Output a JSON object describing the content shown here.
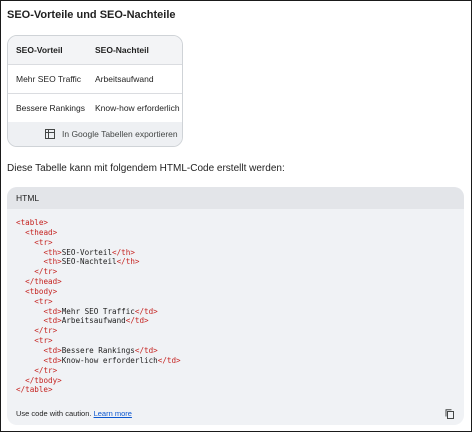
{
  "heading": "SEO-Vorteile und SEO-Nachteile",
  "table": {
    "headers": [
      "SEO-Vorteil",
      "SEO-Nachteil"
    ],
    "rows": [
      [
        "Mehr SEO Traffic",
        "Arbeitsaufwand"
      ],
      [
        "Bessere Rankings",
        "Know-how erforderlich"
      ]
    ],
    "export_label": "In Google Tabellen exportieren",
    "export_icon": "table-icon"
  },
  "intro_text": "Diese Tabelle kann mit folgendem HTML-Code erstellt werden:",
  "code": {
    "language": "HTML",
    "lines": [
      {
        "indent": "",
        "tag_open": "<table>",
        "text": "",
        "tag_close": ""
      },
      {
        "indent": "  ",
        "tag_open": "<thead>",
        "text": "",
        "tag_close": ""
      },
      {
        "indent": "    ",
        "tag_open": "<tr>",
        "text": "",
        "tag_close": ""
      },
      {
        "indent": "      ",
        "tag_open": "<th>",
        "text": "SEO-Vorteil",
        "tag_close": "</th>"
      },
      {
        "indent": "      ",
        "tag_open": "<th>",
        "text": "SEO-Nachteil",
        "tag_close": "</th>"
      },
      {
        "indent": "    ",
        "tag_open": "</tr>",
        "text": "",
        "tag_close": ""
      },
      {
        "indent": "  ",
        "tag_open": "</thead>",
        "text": "",
        "tag_close": ""
      },
      {
        "indent": "  ",
        "tag_open": "<tbody>",
        "text": "",
        "tag_close": ""
      },
      {
        "indent": "    ",
        "tag_open": "<tr>",
        "text": "",
        "tag_close": ""
      },
      {
        "indent": "      ",
        "tag_open": "<td>",
        "text": "Mehr SEO Traffic",
        "tag_close": "</td>"
      },
      {
        "indent": "      ",
        "tag_open": "<td>",
        "text": "Arbeitsaufwand",
        "tag_close": "</td>"
      },
      {
        "indent": "    ",
        "tag_open": "</tr>",
        "text": "",
        "tag_close": ""
      },
      {
        "indent": "    ",
        "tag_open": "<tr>",
        "text": "",
        "tag_close": ""
      },
      {
        "indent": "      ",
        "tag_open": "<td>",
        "text": "Bessere Rankings",
        "tag_close": "</td>"
      },
      {
        "indent": "      ",
        "tag_open": "<td>",
        "text": "Know-how erforderlich",
        "tag_close": "</td>"
      },
      {
        "indent": "    ",
        "tag_open": "</tr>",
        "text": "",
        "tag_close": ""
      },
      {
        "indent": "  ",
        "tag_open": "</tbody>",
        "text": "",
        "tag_close": ""
      },
      {
        "indent": "",
        "tag_open": "</table>",
        "text": "",
        "tag_close": ""
      }
    ],
    "caution_text": "Use code with caution.",
    "learn_more": "Learn more",
    "copy_icon": "copy-icon"
  },
  "colors": {
    "tag": "#c5221f",
    "link": "#0b57d0",
    "code_bg": "#f0f2f5",
    "header_bg": "#e3e5e9"
  }
}
